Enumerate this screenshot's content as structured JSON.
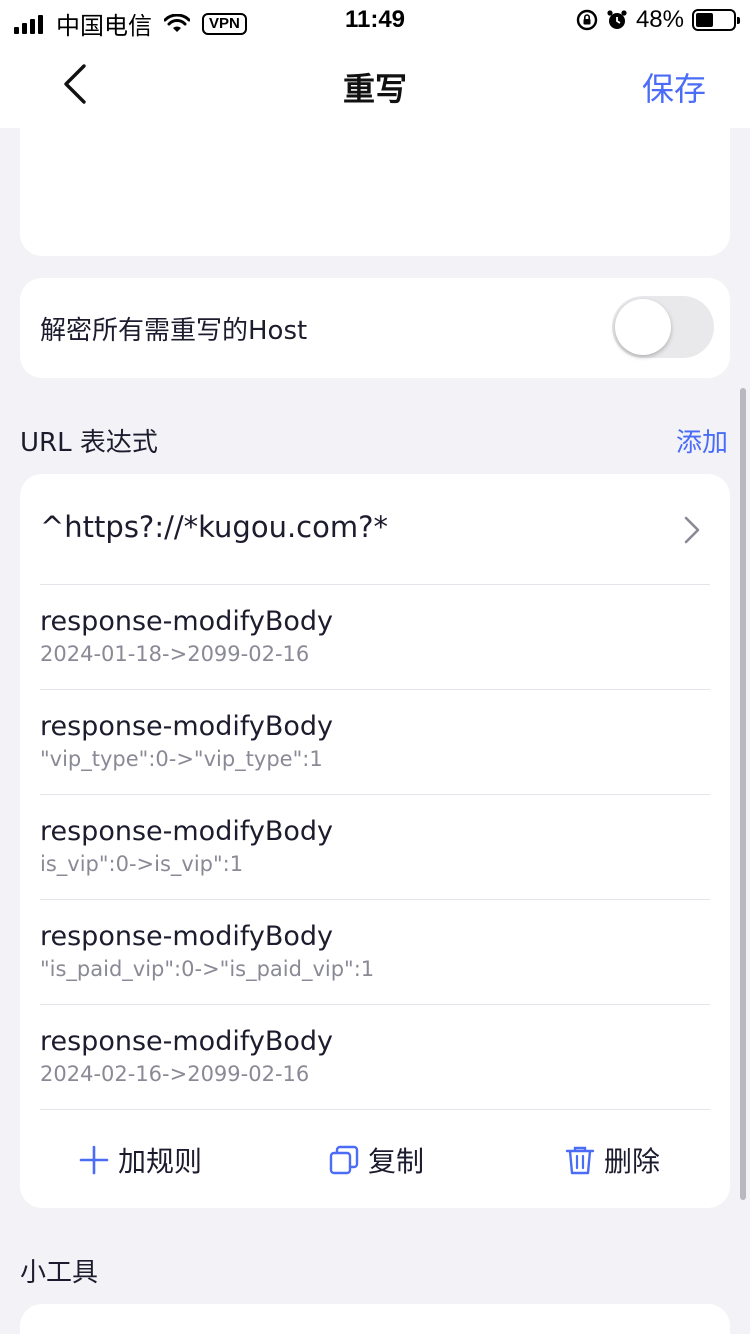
{
  "status": {
    "carrier": "中国电信",
    "vpn": "VPN",
    "time": "11:49",
    "battery": "48%",
    "battery_level": 0.48
  },
  "nav": {
    "title": "重写",
    "save": "保存"
  },
  "toggle_row": {
    "label": "解密所有需重写的Host",
    "enabled": false
  },
  "url_section": {
    "title": "URL 表达式",
    "add": "添加"
  },
  "rules_card": {
    "expression": "^https?://*kugou.com?*",
    "rules": [
      {
        "type": "response-modifyBody",
        "detail": "2024-01-18->2099-02-16"
      },
      {
        "type": "response-modifyBody",
        "detail": "\"vip_type\":0->\"vip_type\":1"
      },
      {
        "type": "response-modifyBody",
        "detail": "is_vip\":0->is_vip\":1"
      },
      {
        "type": "response-modifyBody",
        "detail": "\"is_paid_vip\":0->\"is_paid_vip\":1"
      },
      {
        "type": "response-modifyBody",
        "detail": "2024-02-16->2099-02-16"
      }
    ],
    "actions": {
      "add_rule": "加规则",
      "copy": "复制",
      "delete": "删除"
    }
  },
  "tools_section": {
    "title": "小工具"
  },
  "colors": {
    "accent": "#4a6cf7",
    "background": "#f2f2f7",
    "card": "#ffffff",
    "secondary_text": "#8a8a96"
  }
}
